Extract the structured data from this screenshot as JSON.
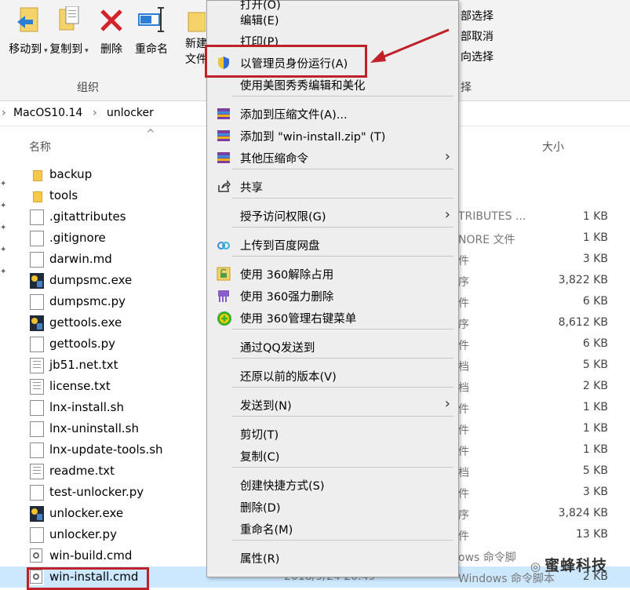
{
  "ribbon": {
    "buttons": [
      {
        "label": "移动到",
        "icon": "move-to-icon"
      },
      {
        "label": "复制到",
        "icon": "copy-to-icon"
      },
      {
        "label": "删除",
        "icon": "delete-icon"
      },
      {
        "label": "重命名",
        "icon": "rename-icon"
      },
      {
        "label": "新建\n文件",
        "icon": "new-folder-icon"
      }
    ],
    "new_label_1": "新建",
    "new_label_2": "文件",
    "group_label": "组织",
    "right_group_label": "择",
    "select_items": [
      "部选择",
      "部取消",
      "向选择"
    ]
  },
  "breadcrumb": {
    "parts": [
      "MacOS10.14",
      "unlocker"
    ]
  },
  "columns": {
    "name": "名称",
    "size": "大小"
  },
  "files": [
    {
      "name": "backup",
      "kind": "folder",
      "type": "",
      "size": ""
    },
    {
      "name": "tools",
      "kind": "folder",
      "type": "",
      "size": ""
    },
    {
      "name": ".gitattributes",
      "kind": "doc",
      "type": "TRIBUTES ...",
      "size": "1 KB"
    },
    {
      "name": ".gitignore",
      "kind": "doc",
      "type": "NORE 文件",
      "size": "1 KB"
    },
    {
      "name": "darwin.md",
      "kind": "doc",
      "type": "件",
      "size": "3 KB"
    },
    {
      "name": "dumpsmc.exe",
      "kind": "exe",
      "type": "序",
      "size": "3,822 KB"
    },
    {
      "name": "dumpsmc.py",
      "kind": "doc",
      "type": "件",
      "size": "6 KB"
    },
    {
      "name": "gettools.exe",
      "kind": "exe",
      "type": "序",
      "size": "8,612 KB"
    },
    {
      "name": "gettools.py",
      "kind": "doc",
      "type": "件",
      "size": "6 KB"
    },
    {
      "name": "jb51.net.txt",
      "kind": "text",
      "type": "档",
      "size": "5 KB"
    },
    {
      "name": "license.txt",
      "kind": "text",
      "type": "档",
      "size": "2 KB"
    },
    {
      "name": "lnx-install.sh",
      "kind": "doc",
      "type": "件",
      "size": "1 KB"
    },
    {
      "name": "lnx-uninstall.sh",
      "kind": "doc",
      "type": "件",
      "size": "1 KB"
    },
    {
      "name": "lnx-update-tools.sh",
      "kind": "doc",
      "type": "件",
      "size": "1 KB"
    },
    {
      "name": "readme.txt",
      "kind": "text",
      "type": "档",
      "size": "5 KB"
    },
    {
      "name": "test-unlocker.py",
      "kind": "doc",
      "type": "件",
      "size": "3 KB"
    },
    {
      "name": "unlocker.exe",
      "kind": "exe",
      "type": "序",
      "size": "3,824 KB"
    },
    {
      "name": "unlocker.py",
      "kind": "doc",
      "type": "件",
      "size": "13 KB"
    },
    {
      "name": "win-build.cmd",
      "kind": "cmd",
      "type": "ows 命令脚",
      "size": ""
    },
    {
      "name": "win-install.cmd",
      "kind": "cmd",
      "type": "Windows 命令脚本",
      "size": "2 KB",
      "date": "2018/9/24 20:49"
    }
  ],
  "menu": {
    "items": [
      {
        "label": "打开(O)",
        "icon": ""
      },
      {
        "label": "编辑(E)",
        "icon": ""
      },
      {
        "label": "打印(P)",
        "icon": ""
      },
      {
        "label": "以管理员身份运行(A)",
        "icon": "uac-shield-icon"
      },
      {
        "label": "使用美图秀秀编辑和美化",
        "icon": ""
      },
      {
        "label": "添加到压缩文件(A)...",
        "icon": "winrar-icon"
      },
      {
        "label": "添加到 \"win-install.zip\" (T)",
        "icon": "winrar-icon"
      },
      {
        "label": "其他压缩命令",
        "icon": "winrar-icon",
        "submenu": true
      },
      {
        "label": "共享",
        "icon": "share-icon"
      },
      {
        "label": "授予访问权限(G)",
        "icon": "",
        "submenu": true
      },
      {
        "label": "上传到百度网盘",
        "icon": "baidu-cloud-icon"
      },
      {
        "label": "使用 360解除占用",
        "icon": "360-unlock-icon"
      },
      {
        "label": "使用 360强力删除",
        "icon": "360-shred-icon"
      },
      {
        "label": "使用 360管理右键菜单",
        "icon": "360-menu-icon"
      },
      {
        "label": "通过QQ发送到",
        "icon": ""
      },
      {
        "label": "还原以前的版本(V)",
        "icon": ""
      },
      {
        "label": "发送到(N)",
        "icon": "",
        "submenu": true
      },
      {
        "label": "剪切(T)",
        "icon": ""
      },
      {
        "label": "复制(C)",
        "icon": ""
      },
      {
        "label": "创建快捷方式(S)",
        "icon": ""
      },
      {
        "label": "删除(D)",
        "icon": ""
      },
      {
        "label": "重命名(M)",
        "icon": ""
      },
      {
        "label": "属性(R)",
        "icon": ""
      }
    ],
    "submenu_glyph": "›"
  },
  "watermark": "蜜蜂科技",
  "colors": {
    "highlight": "#c0202a",
    "selection": "#cce8ff",
    "menu_bg": "#eeeeee"
  }
}
